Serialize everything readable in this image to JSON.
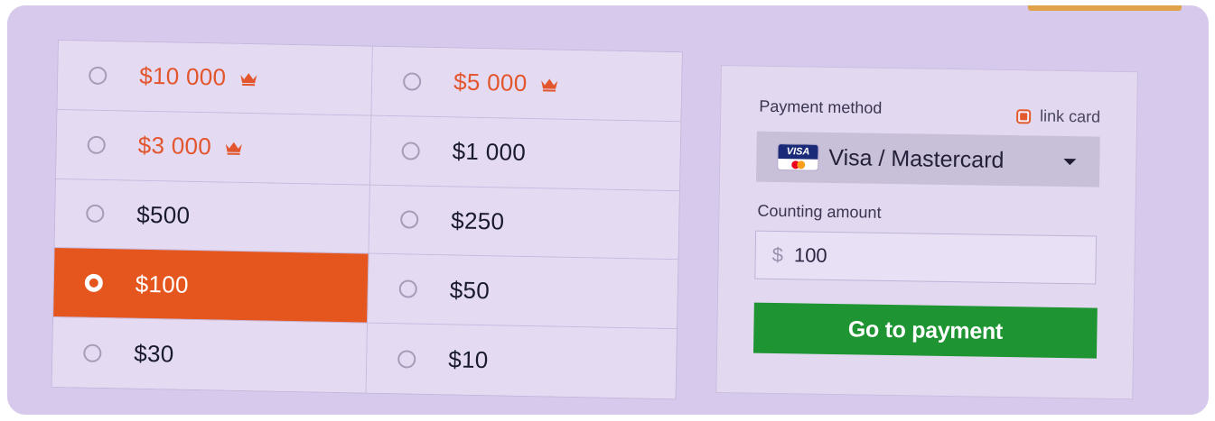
{
  "amounts": [
    {
      "label": "$10 000",
      "premium": true,
      "selected": false
    },
    {
      "label": "$5 000",
      "premium": true,
      "selected": false
    },
    {
      "label": "$3 000",
      "premium": true,
      "selected": false
    },
    {
      "label": "$1 000",
      "premium": false,
      "selected": false
    },
    {
      "label": "$500",
      "premium": false,
      "selected": false
    },
    {
      "label": "$250",
      "premium": false,
      "selected": false
    },
    {
      "label": "$100",
      "premium": false,
      "selected": true
    },
    {
      "label": "$50",
      "premium": false,
      "selected": false
    },
    {
      "label": "$30",
      "premium": false,
      "selected": false
    },
    {
      "label": "$10",
      "premium": false,
      "selected": false
    }
  ],
  "payment": {
    "method_label": "Payment method",
    "link_card_label": "link card",
    "link_card_checked": true,
    "selected_method": "Visa / Mastercard",
    "method_icon": "visa-card-icon",
    "visa_badge_text": "VISA",
    "counting_label": "Counting amount",
    "currency_symbol": "$",
    "amount_value": "100",
    "submit_label": "Go to payment"
  },
  "colors": {
    "accent": "#e5561e",
    "premium_text": "#e2552d",
    "button_green": "#1e9532",
    "background": "#d6c9ec"
  }
}
